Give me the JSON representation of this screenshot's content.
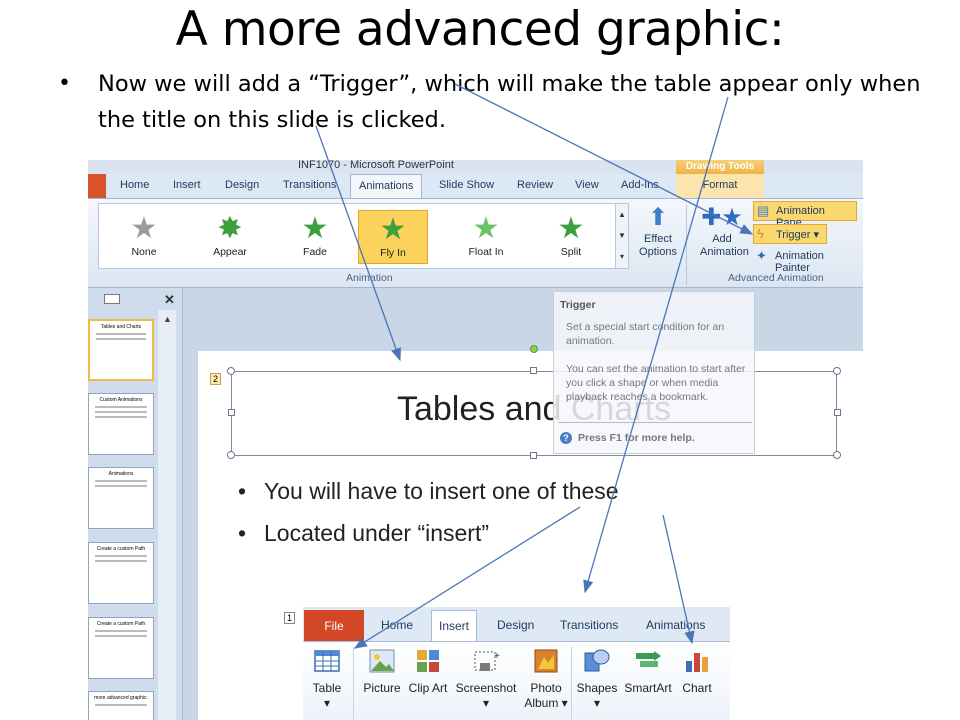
{
  "slide": {
    "title": "A more advanced graphic:",
    "bullet": "Now we will add a “Trigger”, which will make the table appear only when the title on this slide is clicked."
  },
  "ppt": {
    "window_title": "INF1070 - Microsoft PowerPoint",
    "contextual_tab": "Drawing Tools",
    "tabs": [
      "Home",
      "Insert",
      "Design",
      "Transitions",
      "Animations",
      "Slide Show",
      "Review",
      "View",
      "Add-Ins"
    ],
    "active_tab": "Animations",
    "format_tab": "Format",
    "gallery": [
      {
        "label": "None",
        "icon": "star-none-icon",
        "color": "#9a9a9a"
      },
      {
        "label": "Appear",
        "icon": "star-appear-icon",
        "color": "#3ea03a"
      },
      {
        "label": "Fade",
        "icon": "star-fade-icon",
        "color": "#3ea03a"
      },
      {
        "label": "Fly In",
        "icon": "star-flyin-icon",
        "color": "#3ea03a",
        "selected": true
      },
      {
        "label": "Float In",
        "icon": "star-floatin-icon",
        "color": "#6cc16a"
      },
      {
        "label": "Split",
        "icon": "star-split-icon",
        "color": "#3ea03a"
      }
    ],
    "effect_options": [
      "Effect",
      "Options"
    ],
    "add_animation": [
      "Add",
      "Animation"
    ],
    "animation_pane": "Animation Pane",
    "trigger": "Trigger",
    "animation_painter": "Animation Painter",
    "group_animation": "Animation",
    "group_advanced": "Advanced Animation",
    "tooltip": {
      "title": "Trigger",
      "line1": "Set a special start condition for an animation.",
      "line2": "You can set the animation to start after you click a shape or when media playback reaches a bookmark.",
      "help": "Press F1 for more help."
    },
    "thumbnails": [
      {
        "title": "Tables and Charts",
        "selected": true
      },
      {
        "title": "Custom Animations"
      },
      {
        "title": "Animations"
      },
      {
        "title": "Create a custom Path"
      },
      {
        "title": "Create a custom Path"
      },
      {
        "title": "more advanced graphic:"
      }
    ],
    "slide_number_tag": "2",
    "slide_title": "Tables and Charts",
    "slide_bullets": [
      "You will have to insert one of these",
      "Located under “insert”"
    ]
  },
  "insert_ribbon": {
    "number_tag": "1",
    "file_tab": "File",
    "tabs": [
      "Home",
      "Insert",
      "Design",
      "Transitions",
      "Animations"
    ],
    "active_tab": "Insert",
    "buttons": [
      {
        "label": "Table",
        "icon": "table-icon",
        "dropdown": true
      },
      {
        "label": "Picture",
        "icon": "picture-icon"
      },
      {
        "label": "Clip Art",
        "icon": "clip-art-icon"
      },
      {
        "label": "Screenshot",
        "icon": "screenshot-icon",
        "dropdown": true
      },
      {
        "label": "Photo Album",
        "icon": "photo-album-icon",
        "dropdown": true
      },
      {
        "label": "Shapes",
        "icon": "shapes-icon",
        "dropdown": true
      },
      {
        "label": "SmartArt",
        "icon": "smartart-icon"
      },
      {
        "label": "Chart",
        "icon": "chart-icon"
      }
    ]
  },
  "colors": {
    "arrow": "#4a76b8",
    "selected_gallery": "#fbd35c",
    "file_tab": "#d24726"
  }
}
